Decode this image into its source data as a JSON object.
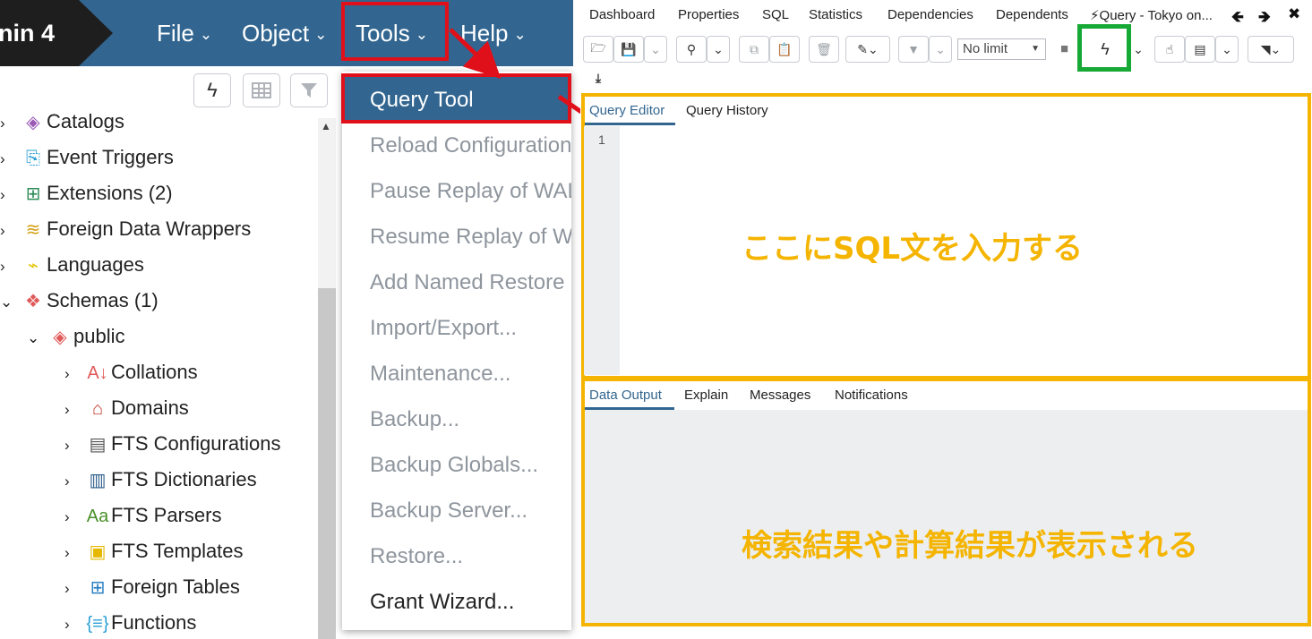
{
  "app": {
    "logo_text": "nin 4"
  },
  "menubar": {
    "items": [
      {
        "label": "File",
        "chevron": "⌄"
      },
      {
        "label": "Object",
        "chevron": "⌄"
      },
      {
        "label": "Tools",
        "chevron": "⌄"
      },
      {
        "label": "Help",
        "chevron": "⌄"
      }
    ]
  },
  "tree": {
    "items": [
      {
        "label": "Catalogs",
        "icon": "catalogs-icon",
        "glyph": "◈",
        "color": "#9b59b6",
        "expand": "›"
      },
      {
        "label": "Event Triggers",
        "icon": "event-triggers-icon",
        "glyph": "⎘",
        "color": "#2a9fd6",
        "expand": "›"
      },
      {
        "label": "Extensions (2)",
        "icon": "extensions-icon",
        "glyph": "⊞",
        "color": "#2e8b57",
        "expand": "›"
      },
      {
        "label": "Foreign Data Wrappers",
        "icon": "foreign-data-wrappers-icon",
        "glyph": "≋",
        "color": "#d4a017",
        "expand": "›"
      },
      {
        "label": "Languages",
        "icon": "languages-icon",
        "glyph": "⌁",
        "color": "#e6c300",
        "expand": "›"
      },
      {
        "label": "Schemas (1)",
        "icon": "schemas-icon",
        "glyph": "❖",
        "color": "#e05a5a",
        "expand": "⌄"
      },
      {
        "label": "public",
        "icon": "public-schema-icon",
        "glyph": "◈",
        "color": "#e05a5a",
        "expand": "⌄"
      },
      {
        "label": "Collations",
        "icon": "collations-icon",
        "glyph": "A↓",
        "color": "#e05a5a",
        "expand": "›"
      },
      {
        "label": "Domains",
        "icon": "domains-icon",
        "glyph": "⌂",
        "color": "#c0392b",
        "expand": "›"
      },
      {
        "label": "FTS Configurations",
        "icon": "fts-configurations-icon",
        "glyph": "▤",
        "color": "#555555",
        "expand": "›"
      },
      {
        "label": "FTS Dictionaries",
        "icon": "fts-dictionaries-icon",
        "glyph": "▥",
        "color": "#2c5d8a",
        "expand": "›"
      },
      {
        "label": "FTS Parsers",
        "icon": "fts-parsers-icon",
        "glyph": "Aa",
        "color": "#4a8f29",
        "expand": "›"
      },
      {
        "label": "FTS Templates",
        "icon": "fts-templates-icon",
        "glyph": "▣",
        "color": "#e6b800",
        "expand": "›"
      },
      {
        "label": "Foreign Tables",
        "icon": "foreign-tables-icon",
        "glyph": "⊞",
        "color": "#2a7fc1",
        "expand": "›"
      },
      {
        "label": "Functions",
        "icon": "functions-icon",
        "glyph": "{≡}",
        "color": "#2a9fd6",
        "expand": "›"
      }
    ]
  },
  "dropdown": {
    "items": [
      "Query Tool",
      "Reload Configuration",
      "Pause Replay of WAL",
      "Resume Replay of WAL",
      "Add Named Restore Point",
      "Import/Export...",
      "Maintenance...",
      "Backup...",
      "Backup Globals...",
      "Backup Server...",
      "Restore...",
      "Grant Wizard..."
    ]
  },
  "right_tabs": {
    "items": [
      "Dashboard",
      "Properties",
      "SQL",
      "Statistics",
      "Dependencies",
      "Dependents",
      "⚡Query - Tokyo on..."
    ]
  },
  "query_toolbar": {
    "limit_value": "No limit"
  },
  "editor": {
    "tabs": [
      "Query Editor",
      "Query History"
    ],
    "line_number": "1",
    "annotation": "ここにSQL文を入力する"
  },
  "results": {
    "tabs": [
      "Data Output",
      "Explain",
      "Messages",
      "Notifications"
    ],
    "annotation": "検索結果や計算結果が表示される"
  },
  "colors": {
    "header_blue": "#326690",
    "highlight_red": "#e0101a",
    "highlight_green": "#16a936",
    "annotation_amber": "#f4b400"
  }
}
